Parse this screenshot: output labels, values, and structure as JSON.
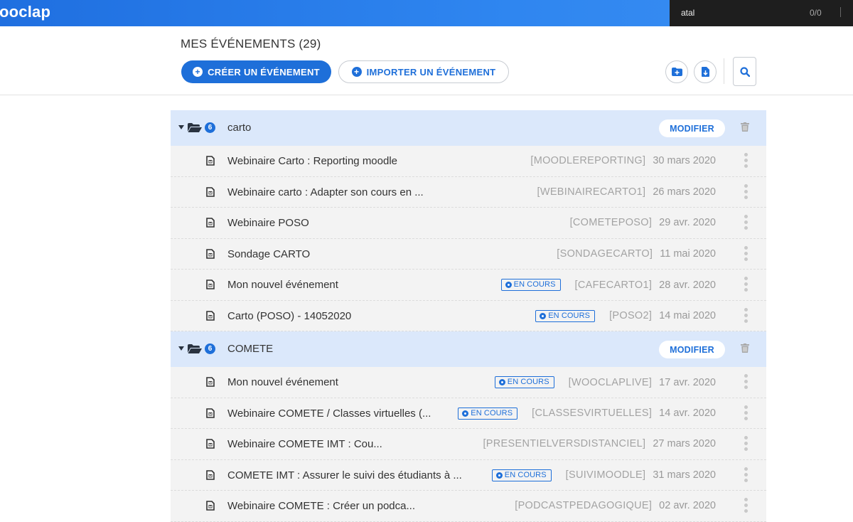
{
  "app": {
    "brand": "ooclap"
  },
  "search_panel": {
    "query": "atal",
    "count": "0/0"
  },
  "header": {
    "title": "MES ÉVÉNEMENTS (29)",
    "create_label": "CRÉER UN ÉVÉNEMENT",
    "import_label": "IMPORTER UN ÉVÉNEMENT"
  },
  "icons": {
    "new_folder": "folder-plus-icon",
    "import_file": "file-import-icon",
    "search": "search-icon"
  },
  "colors": {
    "accent": "#1e6fd9",
    "folder_bg": "#dbe8fb",
    "row_bg": "#f3f3f3"
  },
  "folders": [
    {
      "name": "carto",
      "count": "6",
      "modify_label": "MODIFIER",
      "events": [
        {
          "name": "Webinaire Carto : Reporting moodle",
          "code": "[MOODLEREPORTING]",
          "date": "30 mars 2020",
          "live": false
        },
        {
          "name": "Webinaire carto : Adapter son cours en ...",
          "code": "[WEBINAIRECARTO1]",
          "date": "26 mars 2020",
          "live": false
        },
        {
          "name": "Webinaire POSO",
          "code": "[COMETEPOSO]",
          "date": "29 avr. 2020",
          "live": false
        },
        {
          "name": "Sondage CARTO",
          "code": "[SONDAGECARTO]",
          "date": "11 mai 2020",
          "live": false
        },
        {
          "name": "Mon nouvel événement",
          "code": "[CAFECARTO1]",
          "date": "28 avr. 2020",
          "live": true
        },
        {
          "name": "Carto (POSO) - 14052020",
          "code": "[POSO2]",
          "date": "14 mai 2020",
          "live": true
        }
      ]
    },
    {
      "name": "COMETE",
      "count": "6",
      "modify_label": "MODIFIER",
      "events": [
        {
          "name": "Mon nouvel événement",
          "code": "[WOOCLAPLIVE]",
          "date": "17 avr. 2020",
          "live": true
        },
        {
          "name": "Webinaire COMETE / Classes virtuelles (...",
          "code": "[CLASSESVIRTUELLES]",
          "date": "14 avr. 2020",
          "live": true
        },
        {
          "name": "Webinaire COMETE IMT : Cou...",
          "code": "[PRESENTIELVERSDISTANCIEL]",
          "date": "27 mars 2020",
          "live": false
        },
        {
          "name": "COMETE IMT : Assurer le suivi des étudiants à ...",
          "code": "[SUIVIMOODLE]",
          "date": "31 mars 2020",
          "live": true
        },
        {
          "name": "Webinaire COMETE : Créer un podca...",
          "code": "[PODCASTPEDAGOGIQUE]",
          "date": "02 avr. 2020",
          "live": false
        }
      ]
    }
  ],
  "badge_label": "EN COURS"
}
